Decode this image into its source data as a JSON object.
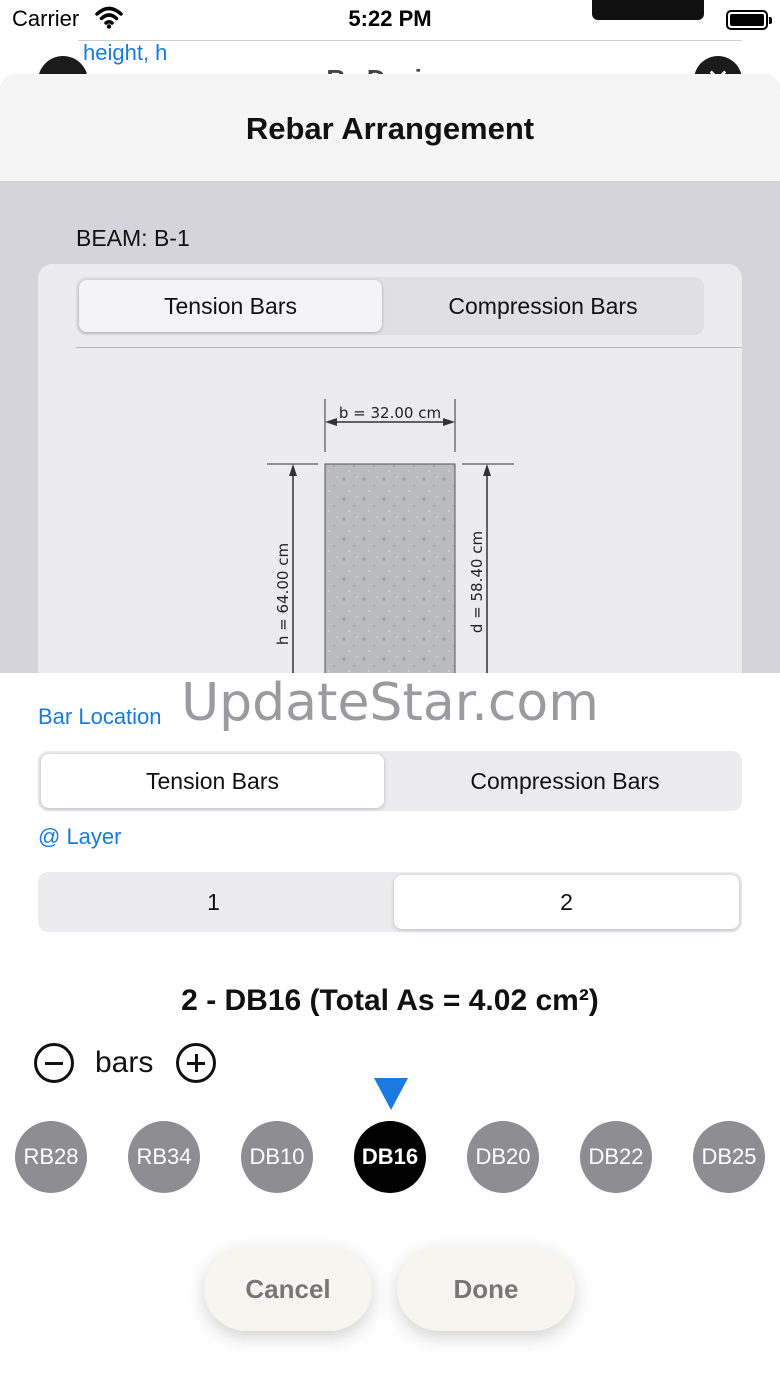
{
  "status_bar": {
    "carrier": "Carrier",
    "time": "5:22 PM"
  },
  "background_screen": {
    "link": "height, h",
    "title": "Rc Design",
    "close_symbol": "✕"
  },
  "sheet": {
    "title": "Rebar Arrangement",
    "beam_label": "BEAM: B-1",
    "segment": {
      "options": [
        "Tension Bars",
        "Compression Bars"
      ],
      "selected": "Tension Bars"
    },
    "diagram": {
      "width_label": "b = 32.00 cm",
      "height_label": "h = 64.00 cm",
      "depth_label": "d = 58.40 cm"
    }
  },
  "watermark": "UpdateStar.com",
  "panel": {
    "bar_location_label": "Bar Location",
    "bar_location_options": [
      "Tension Bars",
      "Compression Bars"
    ],
    "bar_location_selected": "Tension Bars",
    "layer_label": "@ Layer",
    "layer_options": [
      "1",
      "2"
    ],
    "layer_selected": "2",
    "summary": "2 - DB16 (Total As = 4.02 cm²)",
    "bars_label": "bars",
    "bar_sizes": [
      "RB28",
      "RB34",
      "DB10",
      "DB16",
      "DB20",
      "DB22",
      "DB25"
    ],
    "bar_size_selected": "DB16",
    "cancel_label": "Cancel",
    "done_label": "Done"
  },
  "colors": {
    "accent": "#1a7ae0",
    "chip": "#8e8e92",
    "chip_selected": "#000000",
    "sheet_bg": "#d4d4da"
  }
}
